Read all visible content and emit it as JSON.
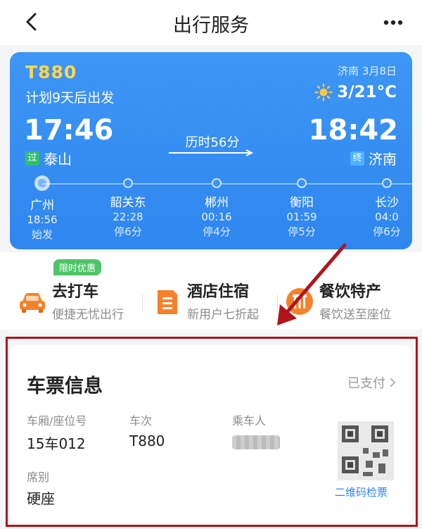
{
  "nav": {
    "title": "出行服务",
    "back_icon": "chevron-left-icon",
    "more_icon": "more-dots-icon"
  },
  "trip": {
    "train_no": "T880",
    "plan": "计划9天后出发",
    "city_date": "济南 3月8日",
    "weather": {
      "icon": "sun-icon",
      "temp": "3/21°C"
    },
    "departure": {
      "time": "17:46",
      "tag": "过",
      "station": "泰山"
    },
    "arrival": {
      "time": "18:42",
      "tag": "终",
      "station": "济南"
    },
    "duration": "历时56分",
    "stops": [
      {
        "name": "广州",
        "time": "18:56",
        "stay": "始发"
      },
      {
        "name": "韶关东",
        "time": "22:28",
        "stay": "停6分"
      },
      {
        "name": "郴州",
        "time": "00:16",
        "stay": "停4分"
      },
      {
        "name": "衡阳",
        "time": "01:59",
        "stay": "停5分"
      },
      {
        "name": "长沙",
        "time": "04:0",
        "stay": "停6分"
      }
    ],
    "colors": {
      "card": "#3d96f5",
      "train_no": "#ffd64d"
    }
  },
  "services": {
    "promo": "限时优惠",
    "items": [
      {
        "name": "去打车",
        "sub": "便捷无忧出行",
        "icon": "car-icon"
      },
      {
        "name": "酒店住宿",
        "sub": "新用户七折起",
        "icon": "hotel-icon"
      },
      {
        "name": "餐饮特产",
        "sub": "餐饮送至座位",
        "icon": "food-icon"
      }
    ]
  },
  "ticket": {
    "title": "车票信息",
    "status": "已支付",
    "seat_label": "车厢/座位号",
    "seat_value": "15车012",
    "train_label": "车次",
    "train_value": "T880",
    "passenger_label": "乘车人",
    "class_label": "席别",
    "class_value": "硬座",
    "qr_label": "二维码检票",
    "highlight_color": "#b0151b"
  }
}
